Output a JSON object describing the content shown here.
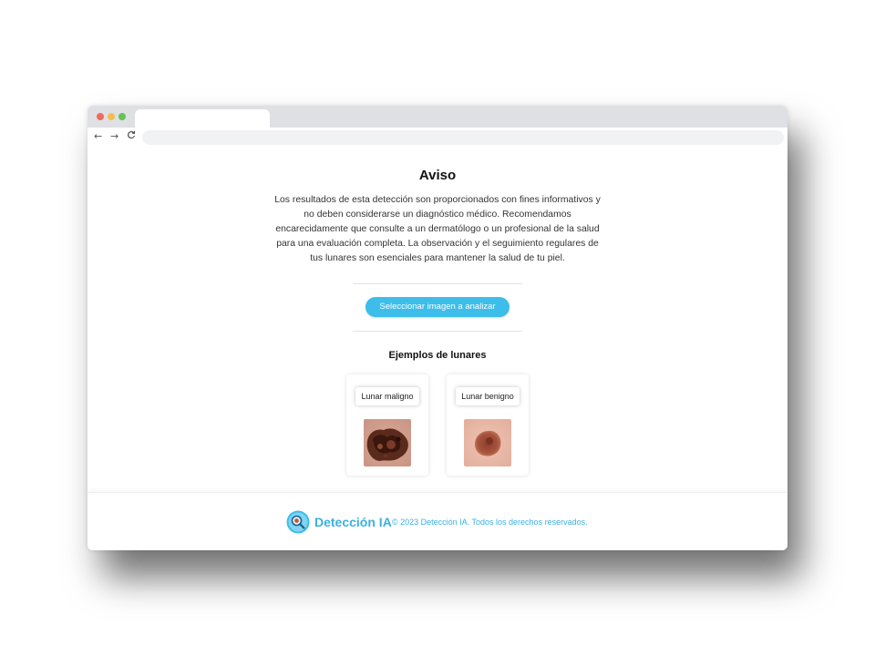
{
  "browser": {
    "nav": {
      "back_icon": "←",
      "forward_icon": "→",
      "reload_icon": "C"
    }
  },
  "notice": {
    "title": "Aviso",
    "text": "Los resultados de esta detección son proporcionados con fines informativos y no deben considerarse un diagnóstico médico. Recomendamos encarecidamente que consulte a un dermatólogo o un profesional de la salud para una evaluación completa. La observación y el seguimiento regulares de tus lunares son esenciales para mantener la salud de tu piel."
  },
  "upload": {
    "button_label": "Seleccionar imagen a analizar"
  },
  "examples": {
    "title": "Ejemplos de lunares",
    "items": [
      {
        "label": "Lunar maligno"
      },
      {
        "label": "Lunar benigno"
      }
    ]
  },
  "footer": {
    "brand": "Detección IA",
    "copyright": "© 2023 Detección IA. Todos los derechos reservados."
  },
  "colors": {
    "accent": "#3cbdea",
    "brand_text": "#3cb0e0"
  }
}
